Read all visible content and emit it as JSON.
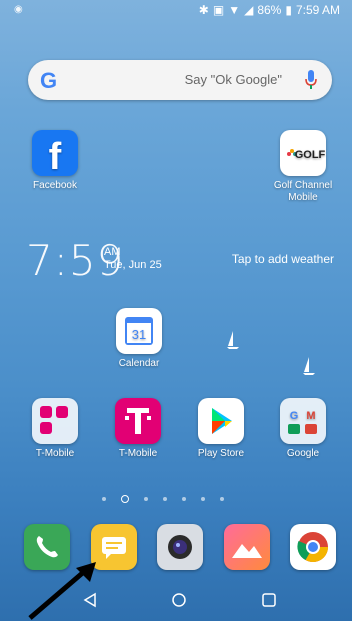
{
  "status": {
    "notification_icon": "wifi-small-icon",
    "battery_percent": "86%",
    "time": "7:59 AM"
  },
  "search": {
    "placeholder": "Say \"Ok Google\""
  },
  "apps_top": [
    {
      "label": "Facebook",
      "icon": "facebook-icon"
    },
    {
      "label": "Golf Channel Mobile",
      "icon": "golf-channel-icon",
      "icon_text": "GOLF"
    }
  ],
  "clock": {
    "time": "7:59",
    "ampm": "AM",
    "date": "Tue, Jun 25",
    "weather": "Tap to add weather"
  },
  "calendar": {
    "label": "Calendar",
    "day": "31"
  },
  "apps_row": [
    {
      "label": "T-Mobile",
      "icon": "tmobile-folder-icon"
    },
    {
      "label": "T-Mobile",
      "icon": "tmobile-icon"
    },
    {
      "label": "Play Store",
      "icon": "play-store-icon"
    },
    {
      "label": "Google",
      "icon": "google-folder-icon"
    }
  ],
  "dock": [
    "phone-icon",
    "messages-icon",
    "camera-icon",
    "gallery-icon",
    "chrome-icon"
  ],
  "colors": {
    "facebook": "#1877f2",
    "tmobile": "#e20074",
    "phone": "#3aa757",
    "messages": "#f7c531"
  }
}
